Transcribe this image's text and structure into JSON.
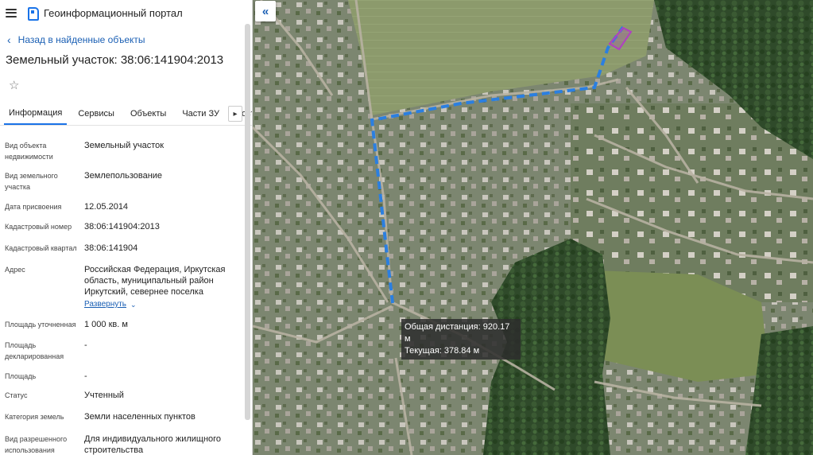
{
  "header": {
    "title": "Геоинформационный портал",
    "menu_icon": "hamburger-icon",
    "logo_icon": "portal-logo-icon"
  },
  "nav": {
    "back_label": "Назад в найденные объекты"
  },
  "object": {
    "title": "Земельный участок: 38:06:141904:2013"
  },
  "tabs": [
    {
      "label": "Информация",
      "active": true
    },
    {
      "label": "Сервисы",
      "active": false
    },
    {
      "label": "Объекты",
      "active": false
    },
    {
      "label": "Части ЗУ",
      "active": false
    },
    {
      "label": "Сост",
      "active": false
    }
  ],
  "properties": [
    {
      "label": "Вид объекта недвижимости",
      "value": "Земельный участок"
    },
    {
      "label": "Вид земельного участка",
      "value": "Землепользование"
    },
    {
      "label": "Дата присвоения",
      "value": "12.05.2014"
    },
    {
      "label": "Кадастровый номер",
      "value": "38:06:141904:2013"
    },
    {
      "label": "Кадастровый квартал",
      "value": "38:06:141904"
    },
    {
      "label": "Адрес",
      "value": "Российская Федерация, Иркутская область, муниципальный район Иркутский, севернее поселка",
      "expand_label": "Развернуть"
    },
    {
      "label": "Площадь уточненная",
      "value": "1 000 кв. м"
    },
    {
      "label": "Площадь декларированная",
      "value": "-"
    },
    {
      "label": "Площадь",
      "value": "-"
    },
    {
      "label": "Статус",
      "value": "Учтенный"
    },
    {
      "label": "Категория земель",
      "value": "Земли населенных пунктов"
    },
    {
      "label": "Вид разрешенного использования",
      "value": "Для индивидуального жилищного строительства"
    }
  ],
  "map": {
    "total_distance": "Общая дистанция: 920.17 м",
    "current_distance": "Текущая: 378.84 м",
    "measure_color": "#2b7fe0",
    "parcel_color": "#b040c0"
  }
}
